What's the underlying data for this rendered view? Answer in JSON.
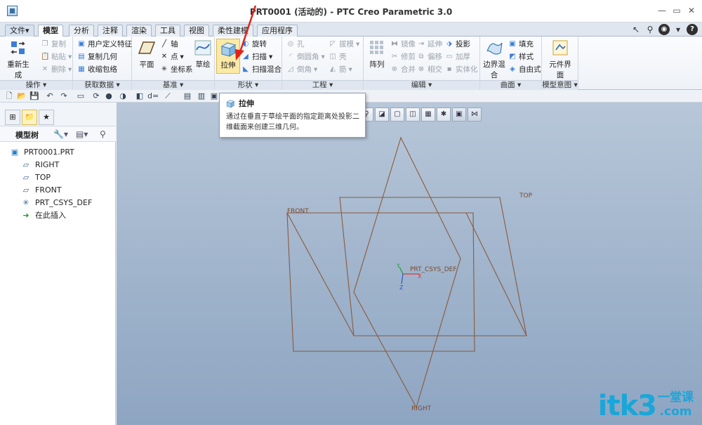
{
  "window": {
    "title": "PRT0001 (活动的) - PTC Creo Parametric 3.0",
    "buttons": {
      "minimize": "—",
      "restore": "▭",
      "close": "✕"
    }
  },
  "tabs": [
    {
      "label": "文件",
      "dropdown": "▾"
    },
    {
      "label": "模型"
    },
    {
      "label": "分析"
    },
    {
      "label": "注释"
    },
    {
      "label": "渲染"
    },
    {
      "label": "工具"
    },
    {
      "label": "视图"
    },
    {
      "label": "柔性建模"
    },
    {
      "label": "应用程序"
    }
  ],
  "ribbon": {
    "operations": {
      "label": "操作",
      "regenerate": "重新生成",
      "copy": "复制",
      "paste": "粘贴",
      "delete": "删除"
    },
    "get_data": {
      "label": "获取数据",
      "udf": "用户定义特征",
      "copy_geometry": "复制几何",
      "shrinkwrap": "收缩包络"
    },
    "datum": {
      "label": "基准",
      "plane": "平面",
      "axis": "轴",
      "point": "点",
      "csys": "坐标系",
      "sketch": "草绘"
    },
    "shapes": {
      "label": "形状",
      "extrude": "拉伸",
      "revolve": "旋转",
      "sweep": "扫描",
      "swept_blend": "扫描混合"
    },
    "engineering": {
      "label": "工程",
      "hole": "孔",
      "draft": "拔模",
      "round": "倒圆角",
      "shell": "壳",
      "chamfer": "倒角",
      "rib": "筋"
    },
    "editing": {
      "label": "编辑",
      "pattern": "阵列",
      "mirror": "镜像",
      "extend": "延伸",
      "project": "投影",
      "trim": "修剪",
      "offset": "偏移",
      "thicken": "加厚",
      "merge": "合并",
      "intersect": "相交",
      "solidify": "实体化"
    },
    "surfaces": {
      "label": "曲面",
      "boundary_blend": "边界混合",
      "fill": "填充",
      "style": "样式",
      "freestyle": "自由式"
    },
    "model_intent": {
      "label": "模型意图",
      "component_interface": "元件界面"
    }
  },
  "tooltip": {
    "title": "拉伸",
    "text": "通过在垂直于草绘平面的指定距离处投影二维截面来创建三维几何。"
  },
  "model_tree": {
    "title": "模型树",
    "items": [
      {
        "label": "PRT0001.PRT",
        "icon": "part-icon"
      },
      {
        "label": "RIGHT",
        "icon": "datum-plane-icon"
      },
      {
        "label": "TOP",
        "icon": "datum-plane-icon"
      },
      {
        "label": "FRONT",
        "icon": "datum-plane-icon"
      },
      {
        "label": "PRT_CSYS_DEF",
        "icon": "csys-icon"
      },
      {
        "label": "在此插入",
        "icon": "insert-arrow-icon"
      }
    ]
  },
  "viewport": {
    "labels": {
      "top": "TOP",
      "front": "FRONT",
      "right": "RIGHT",
      "csys": "PRT_CSYS_DEF",
      "x": "X",
      "y": "Y",
      "z": "Z"
    },
    "plane_color": "#8a5a3c"
  },
  "watermark": {
    "main": "itk3",
    "cn": "一堂课",
    "domain": ".com"
  }
}
